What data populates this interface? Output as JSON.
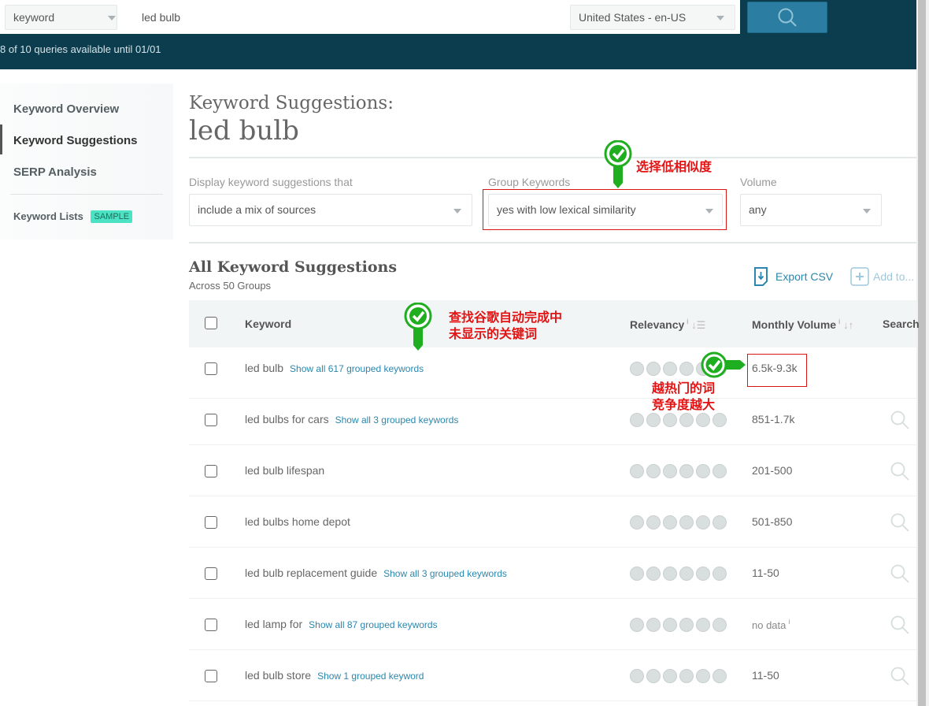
{
  "header": {
    "search_type": "keyword",
    "query": "led bulb",
    "locale": "United States - en-US",
    "queries_status": "8 of 10 queries available until 01/01",
    "search_button_icon": "search-icon"
  },
  "sidebar": {
    "items": [
      {
        "label": "Keyword Overview",
        "active": false
      },
      {
        "label": "Keyword Suggestions",
        "active": true
      },
      {
        "label": "SERP Analysis",
        "active": false
      }
    ],
    "lists_label": "Keyword Lists",
    "lists_badge": "SAMPLE"
  },
  "main": {
    "title_prefix": "Keyword Suggestions:",
    "title_keyword": "led bulb",
    "filters": {
      "display": {
        "label": "Display keyword suggestions that",
        "value": "include a mix of sources"
      },
      "group": {
        "label": "Group Keywords",
        "value": "yes with low lexical similarity"
      },
      "volume": {
        "label": "Volume",
        "value": "any"
      }
    },
    "section_title": "All Keyword Suggestions",
    "section_subtitle": "Across 50 Groups",
    "export_label": "Export CSV",
    "add_to_label": "Add to...",
    "columns": {
      "keyword": "Keyword",
      "relevancy": "Relevancy",
      "volume": "Monthly Volume",
      "search": "Search",
      "info_glyph": "i"
    },
    "rows": [
      {
        "keyword": "led bulb",
        "group_link": "Show all 617 grouped keywords",
        "volume": "6.5k-9.3k",
        "relevancy_dots": 6
      },
      {
        "keyword": "led bulbs for cars",
        "group_link": "Show all 3 grouped keywords",
        "volume": "851-1.7k",
        "relevancy_dots": 6
      },
      {
        "keyword": "led bulb lifespan",
        "group_link": "",
        "volume": "201-500",
        "relevancy_dots": 6
      },
      {
        "keyword": "led bulbs home depot",
        "group_link": "",
        "volume": "501-850",
        "relevancy_dots": 6
      },
      {
        "keyword": "led bulb replacement guide",
        "group_link": "Show all 3 grouped keywords",
        "volume": "11-50",
        "relevancy_dots": 6
      },
      {
        "keyword": "led lamp for",
        "group_link": "Show all 87 grouped keywords",
        "volume": "no data",
        "relevancy_dots": 6
      },
      {
        "keyword": "led bulb store",
        "group_link": "Show 1 grouped keyword",
        "volume": "11-50",
        "relevancy_dots": 6
      }
    ]
  },
  "annotations": {
    "group_note": "选择低相似度",
    "keyword_note_line1": "查找谷歌自动完成中",
    "keyword_note_line2": "未显示的关键词",
    "volume_note_line1": "越热门的词",
    "volume_note_line2": "竞争度越大",
    "color": "#e31313",
    "pin_color": "#1fae1f"
  },
  "colors": {
    "header_bg": "#0b3d4f",
    "search_button": "#2b7ea1",
    "link": "#2b87ad",
    "badge": "#4be3c4"
  }
}
